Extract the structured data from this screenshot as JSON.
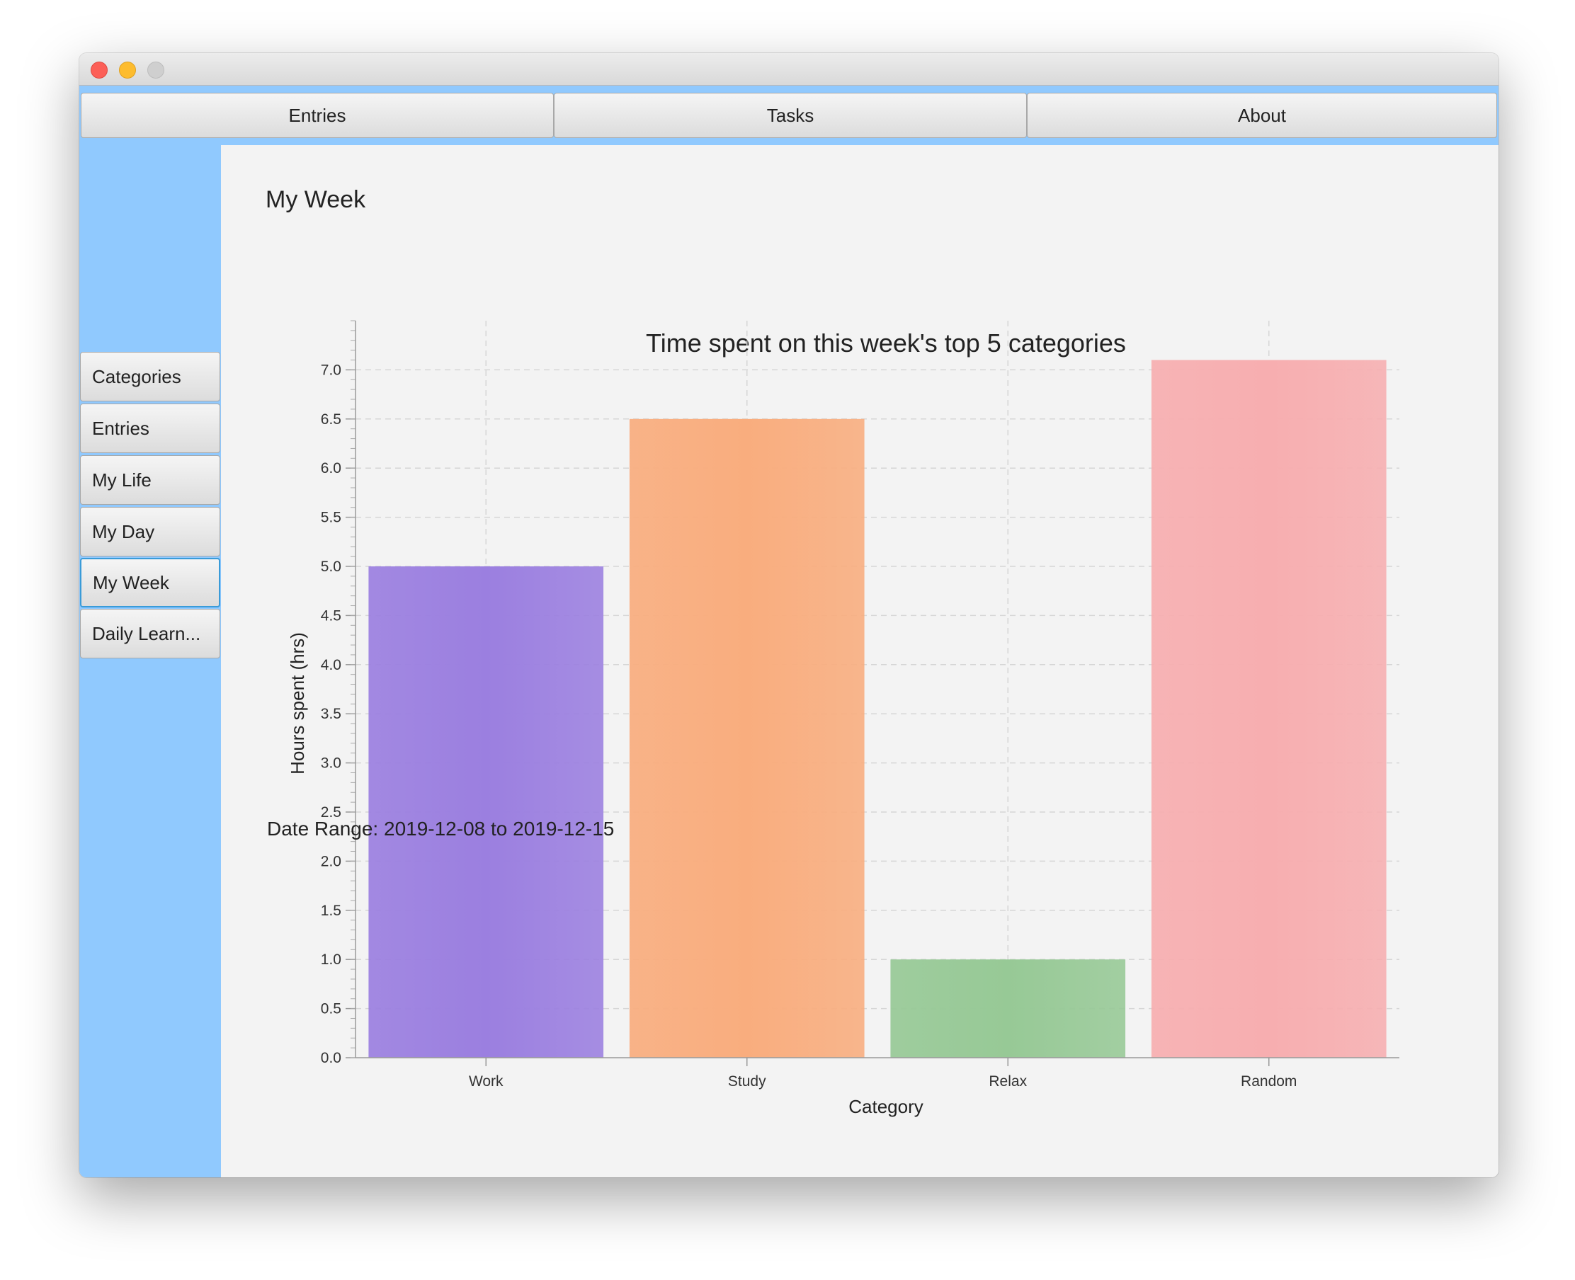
{
  "top_tabs": [
    {
      "label": "Entries"
    },
    {
      "label": "Tasks"
    },
    {
      "label": "About"
    }
  ],
  "sidebar": {
    "items": [
      {
        "label": "Categories"
      },
      {
        "label": "Entries"
      },
      {
        "label": "My Life"
      },
      {
        "label": "My Day"
      },
      {
        "label": "My Week",
        "selected": true
      },
      {
        "label": "Daily Learn..."
      }
    ]
  },
  "main": {
    "title": "My Week",
    "footer": "Date Range: 2019-12-08 to 2019-12-15"
  },
  "colors": {
    "sidebar_bg": "#90c9fe",
    "bar_colors": [
      "#9b7fe0",
      "#f9ad7e",
      "#97c996",
      "#f7aeb0"
    ]
  },
  "chart_data": {
    "type": "bar",
    "title": "Time spent on this week's top 5 categories",
    "xlabel": "Category",
    "ylabel": "Hours spent (hrs)",
    "categories": [
      "Work",
      "Study",
      "Relax",
      "Random"
    ],
    "values": [
      5.0,
      6.5,
      1.0,
      7.1
    ],
    "ylim": [
      0,
      7.5
    ],
    "yticks": [
      "0.0",
      "0.5",
      "1.0",
      "1.5",
      "2.0",
      "2.5",
      "3.0",
      "3.5",
      "4.0",
      "4.5",
      "5.0",
      "5.5",
      "6.0",
      "6.5",
      "7.0"
    ],
    "grid": true,
    "legend": "none"
  }
}
